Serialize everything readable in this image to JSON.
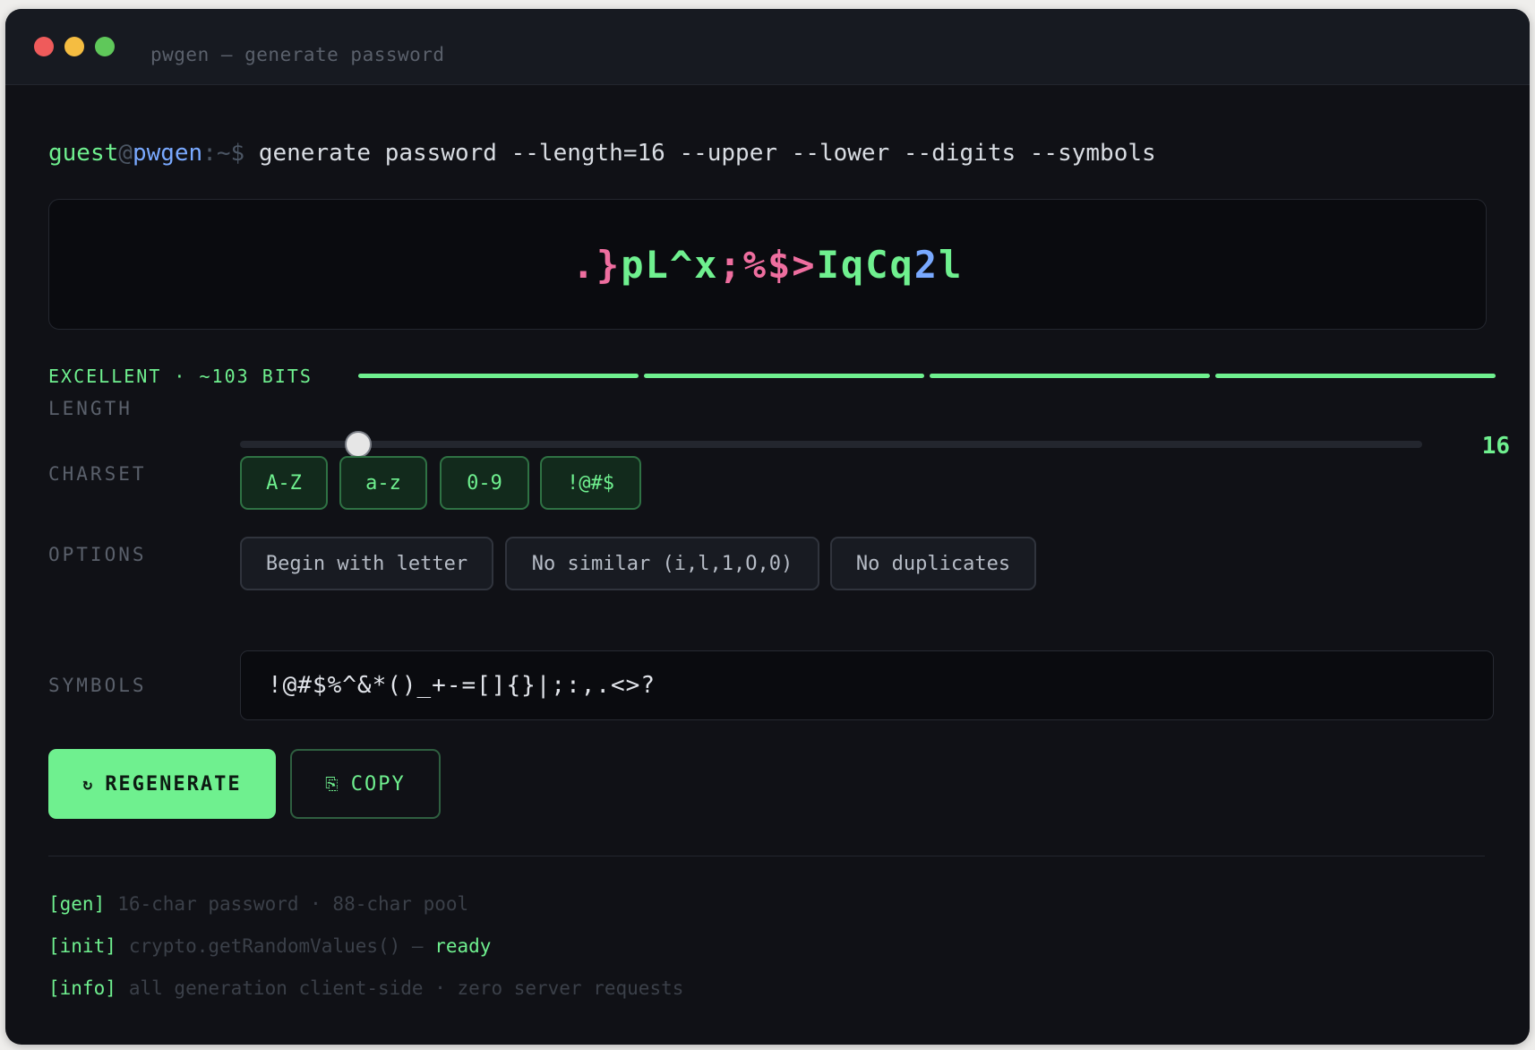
{
  "window": {
    "title": "pwgen — generate password"
  },
  "prompt": {
    "user": "guest",
    "at": "@",
    "host": "pwgen",
    "path": ":~$",
    "command": "generate password --length=16 --upper --lower --digits --symbols"
  },
  "password": {
    "chars": [
      {
        "c": ".",
        "kind": "sym"
      },
      {
        "c": "}",
        "kind": "sym"
      },
      {
        "c": "p",
        "kind": "alpha"
      },
      {
        "c": "L",
        "kind": "alpha"
      },
      {
        "c": "^",
        "kind": "alpha"
      },
      {
        "c": "x",
        "kind": "alpha"
      },
      {
        "c": ";",
        "kind": "sym"
      },
      {
        "c": "%",
        "kind": "sym"
      },
      {
        "c": "$",
        "kind": "sym"
      },
      {
        "c": ">",
        "kind": "sym"
      },
      {
        "c": "I",
        "kind": "alpha"
      },
      {
        "c": "q",
        "kind": "alpha"
      },
      {
        "c": "C",
        "kind": "alpha"
      },
      {
        "c": "q",
        "kind": "alpha"
      },
      {
        "c": "2",
        "kind": "digit"
      },
      {
        "c": "l",
        "kind": "alpha"
      }
    ],
    "colors": {
      "sym": "#ee6e9f",
      "alpha": "#6ff08f",
      "digit": "#79a9ff"
    }
  },
  "strength": {
    "label": "EXCELLENT · ~103 BITS",
    "segments_filled": 4,
    "segments_total": 4,
    "color": "#6ff08f"
  },
  "length": {
    "label": "LENGTH",
    "value": "16",
    "slider_fraction": 0.1
  },
  "charset": {
    "label": "CHARSET",
    "chips": [
      {
        "label": "A-Z",
        "active": true
      },
      {
        "label": "a-z",
        "active": true
      },
      {
        "label": "0-9",
        "active": true
      },
      {
        "label": "!@#$",
        "active": true
      }
    ]
  },
  "options": {
    "label": "OPTIONS",
    "chips": [
      {
        "label": "Begin with letter",
        "active": false
      },
      {
        "label": "No similar (i,l,1,O,0)",
        "active": false
      },
      {
        "label": "No duplicates",
        "active": false
      }
    ]
  },
  "symbols": {
    "label": "SYMBOLS",
    "value": "!@#$%^&*()_+-=[]{}|;:,.<>?"
  },
  "actions": {
    "regenerate": {
      "icon": "↻",
      "label": "REGENERATE"
    },
    "copy": {
      "icon": "⎘",
      "label": "COPY"
    }
  },
  "log": [
    {
      "tag": "[gen]",
      "text": "16-char password · 88-char pool",
      "status": ""
    },
    {
      "tag": "[init]",
      "text": "crypto.getRandomValues() — ",
      "status": "ready"
    },
    {
      "tag": "[info]",
      "text": "all generation client-side · zero server requests",
      "status": ""
    }
  ],
  "colors": {
    "accent": "#6ff08f",
    "background": "#101116",
    "host": "#79a9ff"
  }
}
